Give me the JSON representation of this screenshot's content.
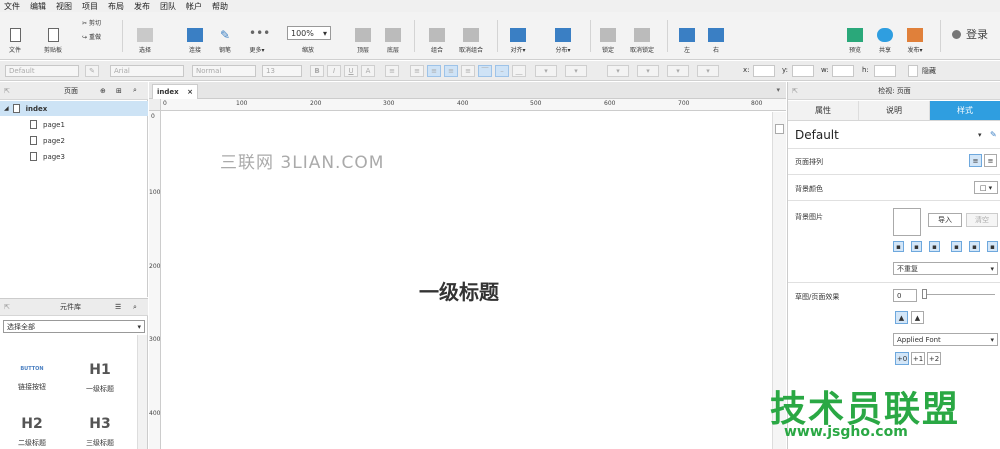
{
  "menu": [
    "文件",
    "编辑",
    "视图",
    "项目",
    "布局",
    "发布",
    "团队",
    "帐户",
    "帮助"
  ],
  "toolbar": {
    "file": "文件",
    "clipboard": "剪贴板",
    "cut": "剪切",
    "redo": "重做",
    "select": "选择",
    "connect": "连接",
    "pen": "钢笔",
    "more": "更多▾",
    "zoom_value": "100%",
    "zoom_label": "缩放",
    "top": "顶层",
    "bottom": "底层",
    "group": "组合",
    "ungroup": "取消组合",
    "align": "对齐▾",
    "distribute": "分布▾",
    "lock": "锁定",
    "unlock": "取消锁定",
    "left": "左",
    "right": "右",
    "preview": "预览",
    "share": "共享",
    "publish": "发布▾",
    "login": "登录"
  },
  "formatbar": {
    "style": "Default",
    "font": "Arial",
    "weight": "Normal",
    "size": "13",
    "x_label": "x:",
    "y_label": "y:",
    "w_label": "w:",
    "h_label": "h:",
    "hidden_label": "隐藏"
  },
  "pages_panel": {
    "title": "页面",
    "items": [
      {
        "label": "index",
        "selected": true
      },
      {
        "label": "page1"
      },
      {
        "label": "page2"
      },
      {
        "label": "page3"
      }
    ]
  },
  "library_panel": {
    "title": "元件库",
    "select_value": "选择全部",
    "widgets": [
      {
        "glyph": "BUTTON",
        "caption": "链接按钮"
      },
      {
        "glyph": "H1",
        "caption": "一级标题"
      },
      {
        "glyph": "H2",
        "caption": "二级标题"
      },
      {
        "glyph": "H3",
        "caption": "三级标题"
      }
    ]
  },
  "canvas": {
    "tab": "index",
    "ruler_h": [
      "0",
      "100",
      "200",
      "300",
      "400",
      "500",
      "600",
      "700",
      "800"
    ],
    "ruler_v": [
      "0",
      "100",
      "200",
      "300",
      "400"
    ],
    "watermark": "三联网 3LIAN.COM",
    "heading": "一级标题"
  },
  "inspector": {
    "header": "检视: 页面",
    "tabs": [
      "属性",
      "说明",
      "样式"
    ],
    "active_tab": "样式",
    "style_name": "Default",
    "page_align_label": "页面排列",
    "bg_color_label": "背景颜色",
    "bg_image_label": "背景图片",
    "import_btn": "导入",
    "clear_btn": "清空",
    "repeat_value": "不重复",
    "sketch_label": "草图/页面效果",
    "sketch_value": "0",
    "font_value": "Applied Font",
    "font_size_steps": [
      "+0",
      "+1",
      "+2"
    ]
  },
  "branding": {
    "logo_text": "技术员联盟",
    "logo_url": "www.jsgho.com",
    "accent": "#2f9ee0",
    "logo_color": "#2aa844"
  }
}
